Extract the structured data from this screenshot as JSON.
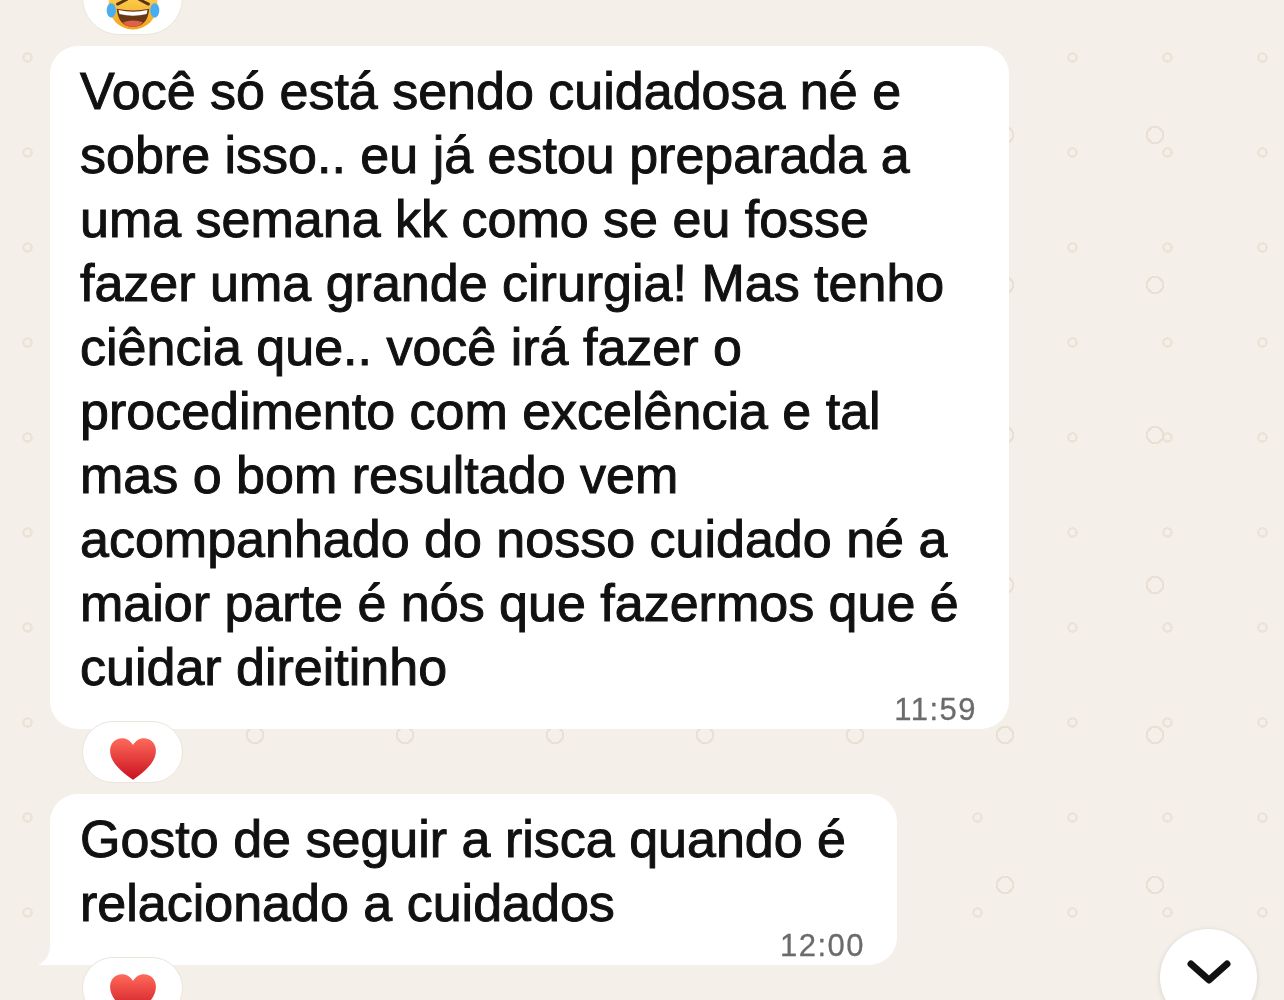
{
  "previous_reaction": {
    "kind": "laughing"
  },
  "messages": [
    {
      "text": "Você só está sendo cuidadosa né e sobre isso.. eu já estou preparada a uma semana kk como se eu fosse fazer uma grande cirurgia! Mas tenho ciência que.. você irá fazer o procedimento com excelência e tal mas o bom resultado vem acompanhado do nosso cuidado né a maior parte é nós que fazermos que é cuidar direitinho",
      "time": "11:59",
      "tail": false,
      "reaction": {
        "kind": "heart"
      }
    },
    {
      "text": "Gosto de seguir a risca quando é relacionado a cuidados",
      "time": "12:00",
      "tail": true,
      "reaction": {
        "kind": "heart"
      }
    }
  ]
}
